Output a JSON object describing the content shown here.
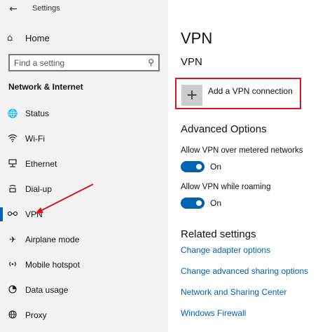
{
  "window": {
    "title": "Settings"
  },
  "sidebar": {
    "back_icon": "arrow-left-icon",
    "home_label": "Home",
    "search": {
      "placeholder": "Find a setting",
      "value": ""
    },
    "section_heading": "Network & Internet",
    "items": [
      {
        "label": "Status",
        "icon": "globe-icon",
        "selected": false
      },
      {
        "label": "Wi-Fi",
        "icon": "wifi-icon",
        "selected": false
      },
      {
        "label": "Ethernet",
        "icon": "ethernet-icon",
        "selected": false
      },
      {
        "label": "Dial-up",
        "icon": "dialup-icon",
        "selected": false
      },
      {
        "label": "VPN",
        "icon": "vpn-icon",
        "selected": true
      },
      {
        "label": "Airplane mode",
        "icon": "airplane-icon",
        "selected": false
      },
      {
        "label": "Mobile hotspot",
        "icon": "hotspot-icon",
        "selected": false
      },
      {
        "label": "Data usage",
        "icon": "data-usage-icon",
        "selected": false
      },
      {
        "label": "Proxy",
        "icon": "proxy-icon",
        "selected": false
      }
    ]
  },
  "main": {
    "page_title": "VPN",
    "vpn_heading": "VPN",
    "add_vpn_label": "Add a VPN connection",
    "advanced_heading": "Advanced Options",
    "options": [
      {
        "label": "Allow VPN over metered networks",
        "state": "On"
      },
      {
        "label": "Allow VPN while roaming",
        "state": "On"
      }
    ],
    "related_heading": "Related settings",
    "links": [
      "Change adapter options",
      "Change advanced sharing options",
      "Network and Sharing Center",
      "Windows Firewall"
    ]
  },
  "colors": {
    "accent": "#0063b1",
    "highlight": "#e0131c"
  }
}
